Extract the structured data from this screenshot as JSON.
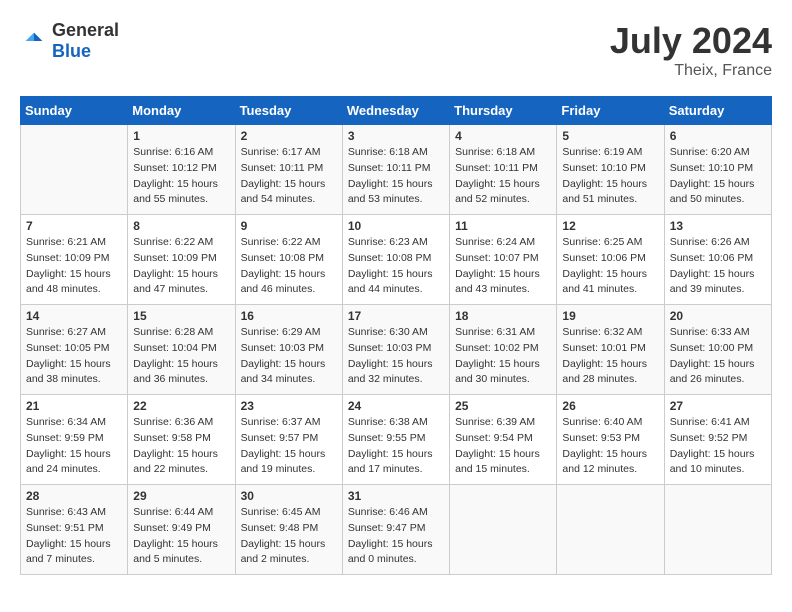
{
  "header": {
    "logo_general": "General",
    "logo_blue": "Blue",
    "month_year": "July 2024",
    "location": "Theix, France"
  },
  "days_of_week": [
    "Sunday",
    "Monday",
    "Tuesday",
    "Wednesday",
    "Thursday",
    "Friday",
    "Saturday"
  ],
  "weeks": [
    [
      {
        "day": "",
        "content": ""
      },
      {
        "day": "1",
        "content": "Sunrise: 6:16 AM\nSunset: 10:12 PM\nDaylight: 15 hours\nand 55 minutes."
      },
      {
        "day": "2",
        "content": "Sunrise: 6:17 AM\nSunset: 10:11 PM\nDaylight: 15 hours\nand 54 minutes."
      },
      {
        "day": "3",
        "content": "Sunrise: 6:18 AM\nSunset: 10:11 PM\nDaylight: 15 hours\nand 53 minutes."
      },
      {
        "day": "4",
        "content": "Sunrise: 6:18 AM\nSunset: 10:11 PM\nDaylight: 15 hours\nand 52 minutes."
      },
      {
        "day": "5",
        "content": "Sunrise: 6:19 AM\nSunset: 10:10 PM\nDaylight: 15 hours\nand 51 minutes."
      },
      {
        "day": "6",
        "content": "Sunrise: 6:20 AM\nSunset: 10:10 PM\nDaylight: 15 hours\nand 50 minutes."
      }
    ],
    [
      {
        "day": "7",
        "content": "Sunrise: 6:21 AM\nSunset: 10:09 PM\nDaylight: 15 hours\nand 48 minutes."
      },
      {
        "day": "8",
        "content": "Sunrise: 6:22 AM\nSunset: 10:09 PM\nDaylight: 15 hours\nand 47 minutes."
      },
      {
        "day": "9",
        "content": "Sunrise: 6:22 AM\nSunset: 10:08 PM\nDaylight: 15 hours\nand 46 minutes."
      },
      {
        "day": "10",
        "content": "Sunrise: 6:23 AM\nSunset: 10:08 PM\nDaylight: 15 hours\nand 44 minutes."
      },
      {
        "day": "11",
        "content": "Sunrise: 6:24 AM\nSunset: 10:07 PM\nDaylight: 15 hours\nand 43 minutes."
      },
      {
        "day": "12",
        "content": "Sunrise: 6:25 AM\nSunset: 10:06 PM\nDaylight: 15 hours\nand 41 minutes."
      },
      {
        "day": "13",
        "content": "Sunrise: 6:26 AM\nSunset: 10:06 PM\nDaylight: 15 hours\nand 39 minutes."
      }
    ],
    [
      {
        "day": "14",
        "content": "Sunrise: 6:27 AM\nSunset: 10:05 PM\nDaylight: 15 hours\nand 38 minutes."
      },
      {
        "day": "15",
        "content": "Sunrise: 6:28 AM\nSunset: 10:04 PM\nDaylight: 15 hours\nand 36 minutes."
      },
      {
        "day": "16",
        "content": "Sunrise: 6:29 AM\nSunset: 10:03 PM\nDaylight: 15 hours\nand 34 minutes."
      },
      {
        "day": "17",
        "content": "Sunrise: 6:30 AM\nSunset: 10:03 PM\nDaylight: 15 hours\nand 32 minutes."
      },
      {
        "day": "18",
        "content": "Sunrise: 6:31 AM\nSunset: 10:02 PM\nDaylight: 15 hours\nand 30 minutes."
      },
      {
        "day": "19",
        "content": "Sunrise: 6:32 AM\nSunset: 10:01 PM\nDaylight: 15 hours\nand 28 minutes."
      },
      {
        "day": "20",
        "content": "Sunrise: 6:33 AM\nSunset: 10:00 PM\nDaylight: 15 hours\nand 26 minutes."
      }
    ],
    [
      {
        "day": "21",
        "content": "Sunrise: 6:34 AM\nSunset: 9:59 PM\nDaylight: 15 hours\nand 24 minutes."
      },
      {
        "day": "22",
        "content": "Sunrise: 6:36 AM\nSunset: 9:58 PM\nDaylight: 15 hours\nand 22 minutes."
      },
      {
        "day": "23",
        "content": "Sunrise: 6:37 AM\nSunset: 9:57 PM\nDaylight: 15 hours\nand 19 minutes."
      },
      {
        "day": "24",
        "content": "Sunrise: 6:38 AM\nSunset: 9:55 PM\nDaylight: 15 hours\nand 17 minutes."
      },
      {
        "day": "25",
        "content": "Sunrise: 6:39 AM\nSunset: 9:54 PM\nDaylight: 15 hours\nand 15 minutes."
      },
      {
        "day": "26",
        "content": "Sunrise: 6:40 AM\nSunset: 9:53 PM\nDaylight: 15 hours\nand 12 minutes."
      },
      {
        "day": "27",
        "content": "Sunrise: 6:41 AM\nSunset: 9:52 PM\nDaylight: 15 hours\nand 10 minutes."
      }
    ],
    [
      {
        "day": "28",
        "content": "Sunrise: 6:43 AM\nSunset: 9:51 PM\nDaylight: 15 hours\nand 7 minutes."
      },
      {
        "day": "29",
        "content": "Sunrise: 6:44 AM\nSunset: 9:49 PM\nDaylight: 15 hours\nand 5 minutes."
      },
      {
        "day": "30",
        "content": "Sunrise: 6:45 AM\nSunset: 9:48 PM\nDaylight: 15 hours\nand 2 minutes."
      },
      {
        "day": "31",
        "content": "Sunrise: 6:46 AM\nSunset: 9:47 PM\nDaylight: 15 hours\nand 0 minutes."
      },
      {
        "day": "",
        "content": ""
      },
      {
        "day": "",
        "content": ""
      },
      {
        "day": "",
        "content": ""
      }
    ]
  ]
}
